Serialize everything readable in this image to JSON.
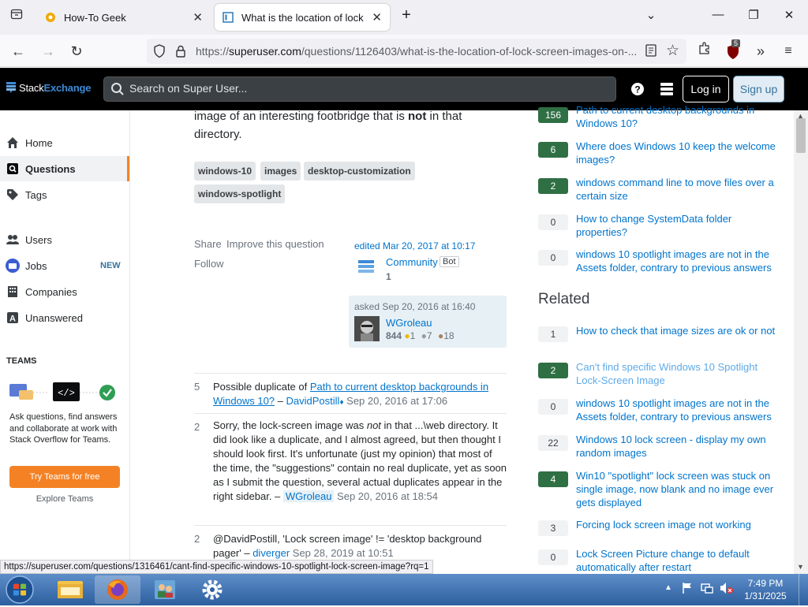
{
  "browser": {
    "tabs": [
      {
        "title": "How-To Geek"
      },
      {
        "title": "What is the location of lock scre"
      }
    ],
    "url_prefix": "https://",
    "url_host": "superuser.com",
    "url_path": "/questions/1126403/what-is-the-location-of-lock-screen-images-on-...",
    "extension_badge": "5"
  },
  "se_header": {
    "logo_a": "Stack",
    "logo_b": "Exchange",
    "search_placeholder": "Search on Super User...",
    "login": "Log in",
    "signup": "Sign up"
  },
  "sidebar": {
    "items": [
      {
        "label": "Home"
      },
      {
        "label": "Questions"
      },
      {
        "label": "Tags"
      },
      {
        "label": "Users"
      },
      {
        "label": "Jobs",
        "badge": "NEW"
      },
      {
        "label": "Companies"
      },
      {
        "label": "Unanswered"
      }
    ],
    "teams_heading": "TEAMS",
    "teams_text": "Ask questions, find answers and collaborate at work with Stack Overflow for Teams.",
    "teams_button": "Try Teams for free",
    "explore": "Explore Teams"
  },
  "question": {
    "body_line1_pre": "image of an interesting footbridge that is ",
    "body_line1_bold": "not",
    "body_line1_post": " in that",
    "body_line2": "directory.",
    "tags": [
      "windows-10",
      "images",
      "desktop-customization",
      "windows-spotlight"
    ],
    "share": "Share",
    "improve": "Improve this question",
    "follow": "Follow",
    "edited": "edited Mar 20, 2017 at 10:17",
    "editor": "Community",
    "editor_badge": "Bot",
    "editor_rep": "1",
    "asked": "asked Sep 20, 2016 at 16:40",
    "author": "WGroleau",
    "author_rep": "844",
    "gold": "1",
    "silver": "7",
    "bronze": "18"
  },
  "comments": [
    {
      "score": "5",
      "pre": "Possible duplicate of ",
      "link": "Path to current desktop backgrounds in Windows 10?",
      "sep": " – ",
      "user": "DavidPostill",
      "diamond": "♦",
      "date": " Sep 20, 2016 at 17:06"
    },
    {
      "score": "2",
      "text_a": "Sorry, the lock-screen image was ",
      "text_em": "not",
      "text_b": " in that ...\\web directory. It did look like a duplicate, and I almost agreed, but then thought I should look first. It's unfortunate (just my opinion) that most of the time, the \"suggestions\" contain no real duplicate, yet as soon as I submit the question, several actual duplicates appear in the right sidebar.",
      "sep": " – ",
      "user": "WGroleau",
      "date": " Sep 20, 2016 at 18:54"
    },
    {
      "score": "2",
      "text": "@DavidPostill, 'Lock screen image' != 'desktop background pager'",
      "sep": " – ",
      "user": "diverger",
      "date": " Sep 28, 2019 at 10:51"
    }
  ],
  "linked": [
    {
      "votes": "156",
      "accepted": true,
      "title": "Path to current desktop backgrounds in Windows 10?"
    },
    {
      "votes": "6",
      "accepted": true,
      "title": "Where does Windows 10 keep the welcome images?"
    },
    {
      "votes": "2",
      "accepted": true,
      "title": "windows command line to move files over a certain size"
    },
    {
      "votes": "0",
      "accepted": false,
      "title": "How to change SystemData folder properties?"
    },
    {
      "votes": "0",
      "accepted": false,
      "title": "windows 10 spotlight images are not in the Assets folder, contrary to previous answers"
    }
  ],
  "related_heading": "Related",
  "related": [
    {
      "votes": "1",
      "accepted": false,
      "title": "How to check that image sizes are ok or not"
    },
    {
      "votes": "2",
      "accepted": true,
      "title": "Can't find specific Windows 10 Spotlight Lock-Screen Image"
    },
    {
      "votes": "0",
      "accepted": false,
      "title": "windows 10 spotlight images are not in the Assets folder, contrary to previous answers"
    },
    {
      "votes": "22",
      "accepted": false,
      "title": "Windows 10 lock screen - display my own random images"
    },
    {
      "votes": "4",
      "accepted": true,
      "title": "Win10 \"spotlight\" lock screen was stuck on single image, now blank and no image ever gets displayed"
    },
    {
      "votes": "3",
      "accepted": false,
      "title": "Forcing lock screen image not working"
    },
    {
      "votes": "0",
      "accepted": false,
      "title": "Lock Screen Picture change to default automatically after restart"
    }
  ],
  "status_url": "https://superuser.com/questions/1316461/cant-find-specific-windows-10-spotlight-lock-screen-image?rq=1",
  "taskbar": {
    "time": "7:49 PM",
    "date": "1/31/2025"
  }
}
